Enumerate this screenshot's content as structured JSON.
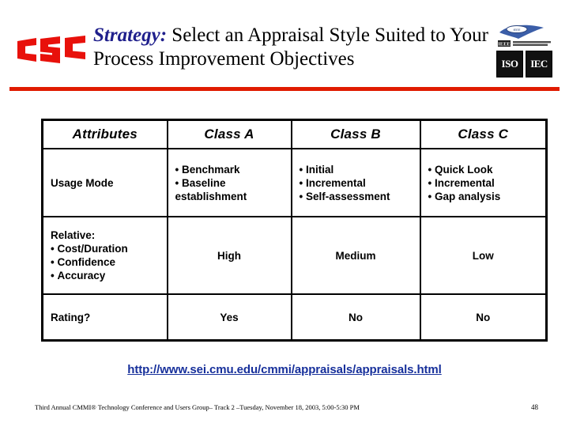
{
  "header": {
    "logo_text": "CSC",
    "logo_color": "#e8110b",
    "title_lead": "Strategy:",
    "title_rest": " Select an Appraisal Style Suited to Your Process Improvement Objectives",
    "title_accent_color": "#1f1f8c",
    "rule_color": "#e01b00",
    "badges": {
      "ieee_label": "IEEE",
      "iso_label": "ISO",
      "iec_label": "IEC"
    }
  },
  "table": {
    "columns": [
      "Attributes",
      "Class A",
      "Class B",
      "Class C"
    ],
    "rows": [
      {
        "attribute": "Usage Mode",
        "class_a": [
          "Benchmark",
          "Baseline",
          "establishment"
        ],
        "class_a_cont": [
          false,
          false,
          true
        ],
        "class_b": [
          "Initial",
          "Incremental",
          "Self-assessment"
        ],
        "class_b_cont": [
          false,
          false,
          false
        ],
        "class_c": [
          "Quick Look",
          "Incremental",
          "Gap analysis"
        ],
        "class_c_cont": [
          false,
          false,
          false
        ]
      },
      {
        "attribute_lines": [
          "Relative:",
          "Cost/Duration",
          "Confidence",
          "Accuracy"
        ],
        "attribute_cont": [
          true,
          false,
          false,
          false
        ],
        "class_a": "High",
        "class_b": "Medium",
        "class_c": "Low"
      },
      {
        "attribute": "Rating?",
        "class_a": "Yes",
        "class_b": "No",
        "class_c": "No"
      }
    ]
  },
  "link": {
    "url_text": "http://www.sei.cmu.edu/cmmi/appraisals/appraisals.html",
    "color": "#17309b"
  },
  "footer": {
    "text": "Third Annual CMMI® Technology Conference and Users Group– Track 2 –Tuesday, November 18, 2003, 5:00-5:30 PM",
    "page_number": "48"
  }
}
